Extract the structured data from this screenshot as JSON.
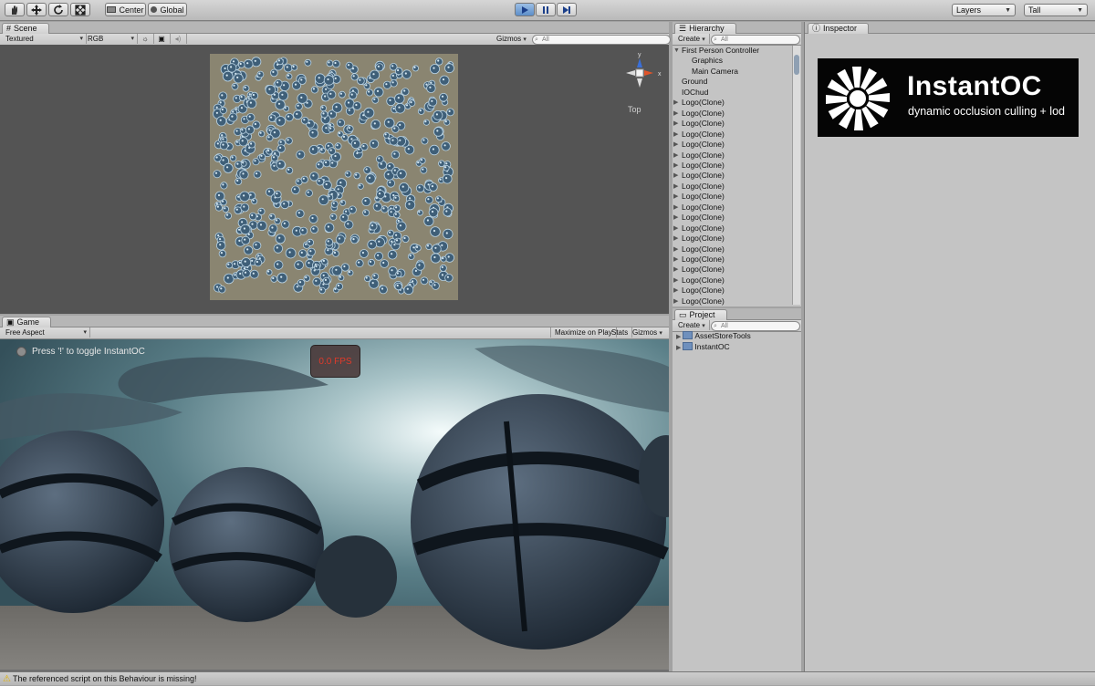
{
  "toolbar": {
    "pivot_label": "Center",
    "space_label": "Global",
    "layers_label": "Layers",
    "layout_label": "Tall"
  },
  "scene": {
    "tab_label": "Scene",
    "render_mode": "Textured",
    "color_mode": "RGB",
    "gizmos_label": "Gizmos",
    "search_placeholder": "All",
    "view_label": "Top",
    "axis_y": "y",
    "axis_x": "x"
  },
  "game": {
    "tab_label": "Game",
    "aspect": "Free Aspect",
    "maximize_label": "Maximize on Play",
    "stats_label": "Stats",
    "gizmos_label": "Gizmos",
    "hint_text": "Press '!' to toggle InstantOC",
    "fps_text": "0.0 FPS"
  },
  "hierarchy": {
    "tab_label": "Hierarchy",
    "create_label": "Create",
    "search_placeholder": "All",
    "items": [
      {
        "label": "First Person Controller",
        "indent": 0,
        "expanded": true
      },
      {
        "label": "Graphics",
        "indent": 1
      },
      {
        "label": "Main Camera",
        "indent": 1
      },
      {
        "label": "Ground",
        "indent": 0
      },
      {
        "label": "IOChud",
        "indent": 0
      },
      {
        "label": "Logo(Clone)",
        "indent": 0,
        "collapsed": true
      },
      {
        "label": "Logo(Clone)",
        "indent": 0,
        "collapsed": true
      },
      {
        "label": "Logo(Clone)",
        "indent": 0,
        "collapsed": true
      },
      {
        "label": "Logo(Clone)",
        "indent": 0,
        "collapsed": true
      },
      {
        "label": "Logo(Clone)",
        "indent": 0,
        "collapsed": true
      },
      {
        "label": "Logo(Clone)",
        "indent": 0,
        "collapsed": true
      },
      {
        "label": "Logo(Clone)",
        "indent": 0,
        "collapsed": true
      },
      {
        "label": "Logo(Clone)",
        "indent": 0,
        "collapsed": true
      },
      {
        "label": "Logo(Clone)",
        "indent": 0,
        "collapsed": true
      },
      {
        "label": "Logo(Clone)",
        "indent": 0,
        "collapsed": true
      },
      {
        "label": "Logo(Clone)",
        "indent": 0,
        "collapsed": true
      },
      {
        "label": "Logo(Clone)",
        "indent": 0,
        "collapsed": true
      },
      {
        "label": "Logo(Clone)",
        "indent": 0,
        "collapsed": true
      },
      {
        "label": "Logo(Clone)",
        "indent": 0,
        "collapsed": true
      },
      {
        "label": "Logo(Clone)",
        "indent": 0,
        "collapsed": true
      },
      {
        "label": "Logo(Clone)",
        "indent": 0,
        "collapsed": true
      },
      {
        "label": "Logo(Clone)",
        "indent": 0,
        "collapsed": true
      },
      {
        "label": "Logo(Clone)",
        "indent": 0,
        "collapsed": true
      },
      {
        "label": "Logo(Clone)",
        "indent": 0,
        "collapsed": true
      },
      {
        "label": "Logo(Clone)",
        "indent": 0,
        "collapsed": true
      },
      {
        "label": "Logo(Clone)",
        "indent": 0,
        "collapsed": true
      },
      {
        "label": "Logo(Clone)",
        "indent": 0,
        "collapsed": true
      }
    ]
  },
  "project": {
    "tab_label": "Project",
    "create_label": "Create",
    "search_placeholder": "All",
    "items": [
      {
        "label": "AssetStoreTools"
      },
      {
        "label": "InstantOC"
      }
    ]
  },
  "inspector": {
    "tab_label": "Inspector",
    "logo_title": "InstantOC",
    "logo_subtitle": "dynamic occlusion culling + lod"
  },
  "status": {
    "message": "The referenced script on this Behaviour is missing!"
  },
  "colors": {
    "play_active": "#5d8ec9",
    "fps_text": "#e03a2a",
    "warning": "#e0b000",
    "axis_x": "#e0542a",
    "axis_y": "#3a6fd8"
  }
}
